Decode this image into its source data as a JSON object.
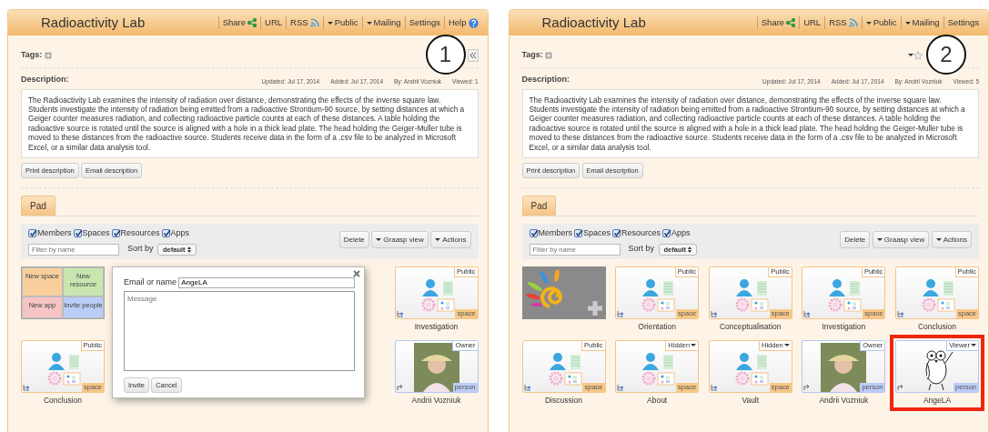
{
  "panels": [
    {
      "title": "Radioactivity Lab",
      "callout": "1",
      "collapse_button": true,
      "menu": [
        {
          "label": "Share",
          "kind": "share"
        },
        {
          "label": "URL",
          "kind": "plain"
        },
        {
          "label": "RSS",
          "kind": "rss"
        },
        {
          "label": "Public",
          "kind": "dropdown"
        },
        {
          "label": "Mailing",
          "kind": "dropdown"
        },
        {
          "label": "Settings",
          "kind": "plain"
        },
        {
          "label": "Help",
          "kind": "help"
        }
      ],
      "tags_label": "Tags:",
      "description_label": "Description:",
      "meta": [
        {
          "label": "Updated:",
          "value": "Jul 17, 2014"
        },
        {
          "label": "Added:",
          "value": "Jul 17, 2014"
        },
        {
          "label": "By:",
          "value": "Andrii Vozniuk"
        },
        {
          "label": "Viewed:",
          "value": "1"
        }
      ],
      "description": "The Radioactivity Lab examines the intensity of radiation over distance, demonstrating the effects of the inverse square law. Students investigate the intensity of radiation being emitted from a radioactive Strontium-90 source, by setting distances at which a Geiger counter measures radiation, and collecting radioactive particle counts at each of these distances. A table holding the radioactive source is rotated until the source is aligned with a hole in a thick lead plate. The head holding the Geiger-Muller tube is moved to these distances from the radioactive source. Students receive data in the form of a .csv file to be analyzed in Microsoft Excel, or a similar data analysis tool.",
      "description_buttons": [
        "Print description",
        "Email description"
      ],
      "tab": "Pad",
      "filters": [
        {
          "label": "Members",
          "checked": true
        },
        {
          "label": "Spaces",
          "checked": true
        },
        {
          "label": "Resources",
          "checked": true
        },
        {
          "label": "Apps",
          "checked": true
        }
      ],
      "filter_placeholder": "Filter by name",
      "sort_label": "Sort by",
      "sort_value": "default",
      "actions": [
        {
          "label": "Delete",
          "dropdown": false
        },
        {
          "label": "Graasp view",
          "dropdown": true
        },
        {
          "label": "Actions",
          "dropdown": true
        }
      ],
      "rows": [
        [
          {
            "kind": "create",
            "options": [
              {
                "label": "New space",
                "color": "#f8cf9c"
              },
              {
                "label": "New resource",
                "color": "#c9e6b0"
              },
              {
                "label": "New app",
                "color": "#f6c4c4"
              },
              {
                "label": "Invite people",
                "color": "#b9cdf8"
              }
            ]
          },
          {
            "kind": "space",
            "name": "Investigation",
            "badge": "Public",
            "badge_menu": false,
            "type": "space",
            "highlighted": false
          }
        ],
        [
          {
            "kind": "space",
            "name": "Conclusion",
            "badge": "Public",
            "badge_menu": false,
            "type": "space",
            "highlighted": false
          },
          {
            "kind": "photo",
            "name": "Andrii Vozniuk",
            "badge": "Owner",
            "badge_menu": false,
            "type": "person",
            "highlighted": false
          }
        ]
      ],
      "popup": {
        "field_label": "Email or name",
        "field_value": "AngeLA",
        "message_placeholder": "Message",
        "buttons": [
          "Invite",
          "Cancel"
        ]
      }
    },
    {
      "title": "Radioactivity Lab",
      "callout": "2",
      "star_menu": true,
      "menu": [
        {
          "label": "Share",
          "kind": "share"
        },
        {
          "label": "URL",
          "kind": "plain"
        },
        {
          "label": "RSS",
          "kind": "rss"
        },
        {
          "label": "Public",
          "kind": "dropdown"
        },
        {
          "label": "Mailing",
          "kind": "dropdown"
        },
        {
          "label": "Settings",
          "kind": "plain"
        }
      ],
      "tags_label": "Tags:",
      "description_label": "Description:",
      "meta": [
        {
          "label": "Updated:",
          "value": "Jul 17, 2014"
        },
        {
          "label": "Added:",
          "value": "Jul 17, 2014"
        },
        {
          "label": "By:",
          "value": "Andrii Vozniuk"
        },
        {
          "label": "Viewed:",
          "value": "5"
        }
      ],
      "description": "The Radioactivity Lab examines the intensity of radiation over distance, demonstrating the effects of the inverse square law. Students investigate the intensity of radiation being emitted from a radioactive Strontium-90 source, by setting distances at which a Geiger counter measures radiation, and collecting radioactive particle counts at each of these distances. A table holding the radioactive source is rotated until the source is aligned with a hole in a thick lead plate. The head holding the Geiger-Muller tube is moved to these distances from the radioactive source. Students receive data in the form of a .csv file to be analyzed in Microsoft Excel, or a similar data analysis tool.",
      "description_buttons": [
        "Print description",
        "Email description"
      ],
      "tab": "Pad",
      "filters": [
        {
          "label": "Members",
          "checked": true
        },
        {
          "label": "Spaces",
          "checked": true
        },
        {
          "label": "Resources",
          "checked": true
        },
        {
          "label": "Apps",
          "checked": true
        }
      ],
      "filter_placeholder": "Filter by name",
      "sort_label": "Sort by",
      "sort_value": "default",
      "actions": [
        {
          "label": "Delete",
          "dropdown": false
        },
        {
          "label": "Graasp view",
          "dropdown": true
        },
        {
          "label": "Actions",
          "dropdown": true
        }
      ],
      "rows": [
        [
          {
            "kind": "add"
          },
          {
            "kind": "space",
            "name": "Orientation",
            "badge": "Public",
            "badge_menu": false,
            "type": "space",
            "highlighted": false
          },
          {
            "kind": "space",
            "name": "Conceptualisation",
            "badge": "Public",
            "badge_menu": false,
            "type": "space",
            "highlighted": false
          },
          {
            "kind": "space",
            "name": "Investigation",
            "badge": "Public",
            "badge_menu": false,
            "type": "space",
            "highlighted": false
          },
          {
            "kind": "space",
            "name": "Conclusion",
            "badge": "Public",
            "badge_menu": false,
            "type": "space",
            "highlighted": false
          }
        ],
        [
          {
            "kind": "space",
            "name": "Discussion",
            "badge": "Public",
            "badge_menu": false,
            "type": "space",
            "highlighted": false
          },
          {
            "kind": "space",
            "name": "About",
            "badge": "Hidden",
            "badge_menu": true,
            "type": "space",
            "highlighted": false
          },
          {
            "kind": "space",
            "name": "Vault",
            "badge": "Hidden",
            "badge_menu": true,
            "type": "space",
            "highlighted": false
          },
          {
            "kind": "photo",
            "name": "Andrii Vozniuk",
            "badge": "Owner",
            "badge_menu": false,
            "type": "person",
            "highlighted": false
          },
          {
            "kind": "drawing",
            "name": "AngeLA",
            "badge": "Viewer",
            "badge_menu": true,
            "type": "person",
            "highlighted": true
          }
        ]
      ]
    }
  ]
}
